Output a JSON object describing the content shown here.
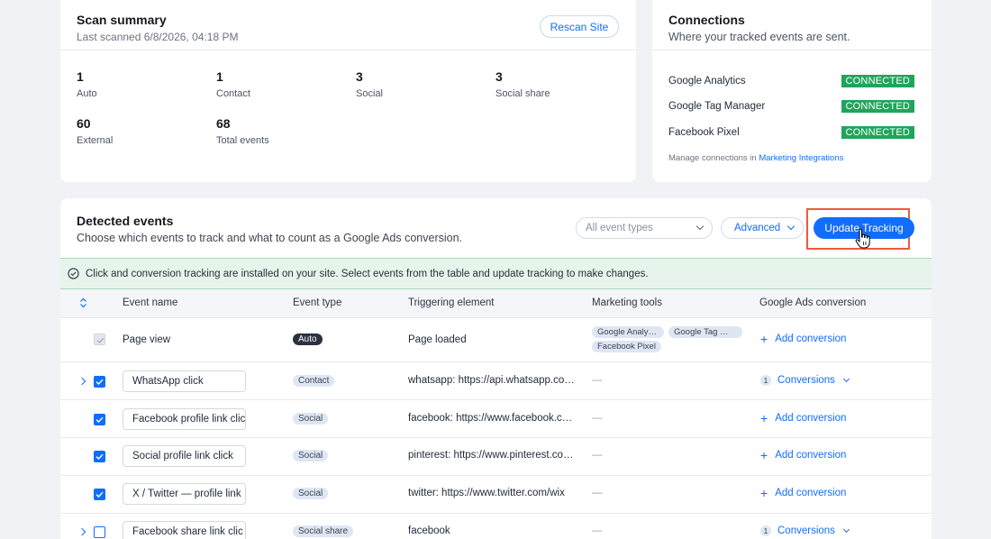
{
  "scan": {
    "title": "Scan summary",
    "subtitle": "Last scanned 6/8/2026, 04:18 PM",
    "rescan_label": "Rescan Site",
    "stats": [
      {
        "value": "1",
        "label": "Auto"
      },
      {
        "value": "1",
        "label": "Contact"
      },
      {
        "value": "3",
        "label": "Social"
      },
      {
        "value": "3",
        "label": "Social share"
      },
      {
        "value": "60",
        "label": "External"
      },
      {
        "value": "68",
        "label": "Total events"
      }
    ]
  },
  "connections": {
    "title": "Connections",
    "subtitle": "Where your tracked events are sent.",
    "items": [
      {
        "name": "Google Analytics",
        "status": "CONNECTED"
      },
      {
        "name": "Google Tag Manager",
        "status": "CONNECTED"
      },
      {
        "name": "Facebook Pixel",
        "status": "CONNECTED"
      }
    ],
    "manage_text": "Manage connections in",
    "manage_link": "Marketing Integrations"
  },
  "events": {
    "title": "Detected events",
    "subtitle": "Choose which events to track and what to count as a Google Ads conversion.",
    "type_filter_placeholder": "All event types",
    "advanced_label": "Advanced",
    "update_label": "Update Tracking",
    "notice": "Click and conversion tracking are installed on your site. Select events from the table and update tracking to make changes.",
    "columns": [
      "Event name",
      "Event type",
      "Triggering element",
      "Marketing tools",
      "Google Ads conversion"
    ],
    "rows": [
      {
        "name": "Page view",
        "type": "Auto",
        "trigger": "Page loaded",
        "tools": [
          "Google Analy…",
          "Google Tag …",
          "Facebook Pixel"
        ],
        "conversion": "Add conversion"
      },
      {
        "name": "WhatsApp click",
        "type": "Contact",
        "trigger": "whatsapp: https://api.whatsapp.co…",
        "tools_empty": "—",
        "conv_count": "1",
        "conversion": "Conversions"
      },
      {
        "name": "Facebook profile link clic",
        "type": "Social",
        "trigger": "facebook: https://www.facebook.c…",
        "tools_empty": "—",
        "conversion": "Add conversion"
      },
      {
        "name": "Social profile link click",
        "type": "Social",
        "trigger": "pinterest: https://www.pinterest.co…",
        "tools_empty": "—",
        "conversion": "Add conversion"
      },
      {
        "name": "X / Twitter — profile link",
        "type": "Social",
        "trigger": "twitter: https://www.twitter.com/wix",
        "tools_empty": "—",
        "conversion": "Add conversion"
      },
      {
        "name": "Facebook share link clic",
        "type": "Social share",
        "trigger": "facebook",
        "tools_empty": "—",
        "conv_count": "1",
        "conversion": "Conversions"
      }
    ]
  },
  "colors": {
    "accent": "#116dff",
    "connected": "#1fa55b",
    "highlight": "#ee5a3e"
  }
}
